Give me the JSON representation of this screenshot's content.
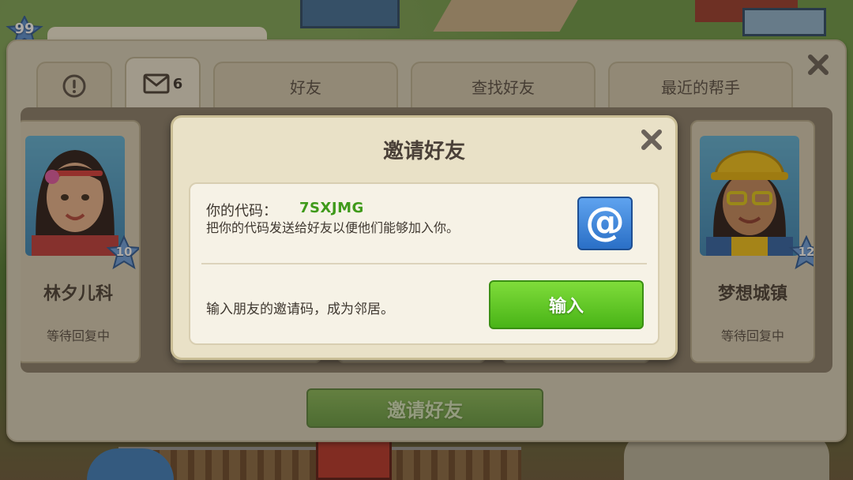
{
  "hud": {
    "player_level": "99"
  },
  "tabs": [
    {
      "id": "alerts",
      "label": "",
      "icon": "exclamation-icon"
    },
    {
      "id": "mail",
      "label": "",
      "icon": "envelope-icon",
      "count": "6"
    },
    {
      "id": "friends",
      "label": "好友"
    },
    {
      "id": "find_friends",
      "label": "查找好友"
    },
    {
      "id": "recent_helpers",
      "label": "最近的帮手"
    }
  ],
  "cards": [
    {
      "name": "林夕儿科",
      "level": "10",
      "status": "等待回复中"
    },
    {
      "name": "梦想城镇",
      "level": "12",
      "status": "等待回复中"
    }
  ],
  "main_invite_button": "邀请好友",
  "dialog": {
    "title": "邀请好友",
    "code_label": "你的代码：",
    "code_value": "7SXJMG",
    "share_description": "把你的代码发送给好友以便他们能够加入你。",
    "share_icon": "at-sign-icon",
    "enter_description": "输入朋友的邀请码，成为邻居。",
    "enter_button": "输入"
  },
  "colors": {
    "accent_green": "#49b417",
    "code_green": "#3f9a1a",
    "share_blue": "#2a6fc6"
  }
}
